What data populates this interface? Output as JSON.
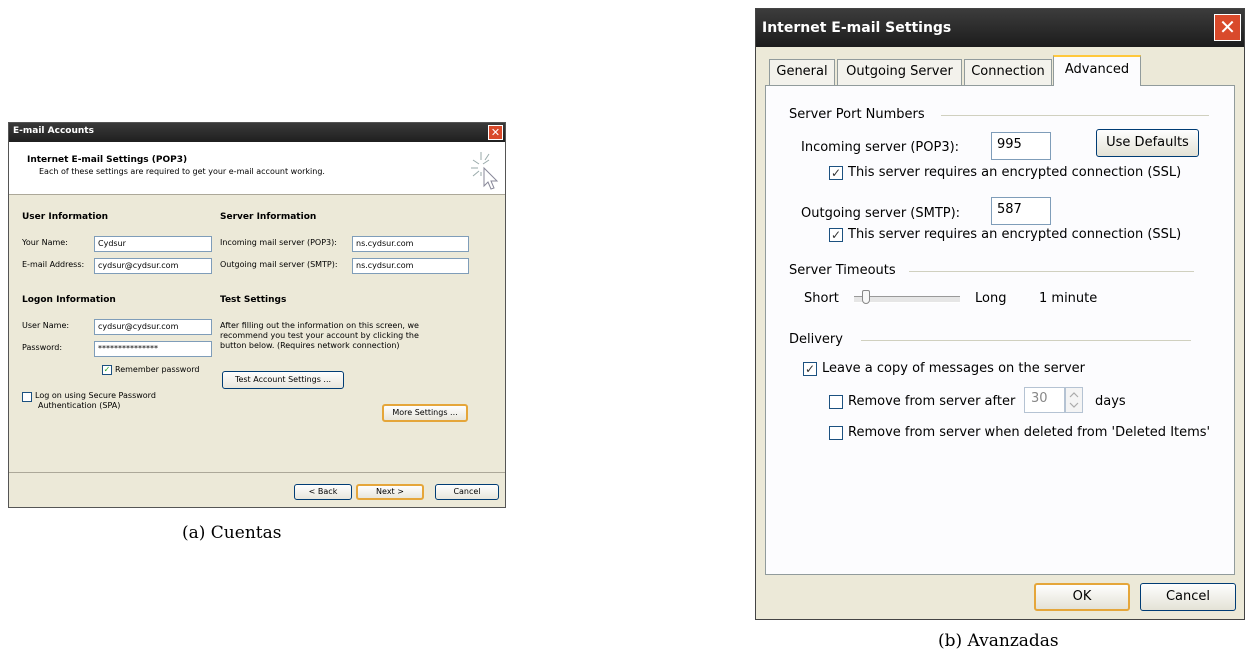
{
  "left": {
    "title": "E-mail Accounts",
    "close_glyph": "✕",
    "header_title": "Internet E-mail Settings (POP3)",
    "header_subtitle": "Each of these settings are required to get your e-mail account working.",
    "user_info": {
      "heading": "User Information",
      "name_label": "Your Name:",
      "name_value": "Cydsur",
      "email_label": "E-mail Address:",
      "email_value": "cydsur@cydsur.com"
    },
    "server_info": {
      "heading": "Server Information",
      "incoming_label": "Incoming mail server (POP3):",
      "incoming_value": "ns.cydsur.com",
      "outgoing_label": "Outgoing mail server (SMTP):",
      "outgoing_value": "ns.cydsur.com"
    },
    "logon_info": {
      "heading": "Logon Information",
      "username_label": "User Name:",
      "username_value": "cydsur@cydsur.com",
      "password_label": "Password:",
      "password_value": "***************",
      "remember_label": "Remember password",
      "remember_checked": true,
      "spa_label_line1": "Log on using Secure Password",
      "spa_label_line2": "Authentication (SPA)",
      "spa_checked": false
    },
    "test_settings": {
      "heading": "Test Settings",
      "text_line1": "After filling out the information on this screen, we",
      "text_line2": "recommend you test your account by clicking the",
      "text_line3": "button below. (Requires network connection)",
      "test_button": "Test Account Settings ...",
      "more_button": "More Settings ..."
    },
    "footer": {
      "back": "< Back",
      "next": "Next >",
      "cancel": "Cancel"
    },
    "caption": "(a) Cuentas"
  },
  "right": {
    "title": "Internet E-mail Settings",
    "close_glyph": "✕",
    "tabs": [
      {
        "label": "General",
        "active": false
      },
      {
        "label": "Outgoing Server",
        "active": false
      },
      {
        "label": "Connection",
        "active": false
      },
      {
        "label": "Advanced",
        "active": true
      }
    ],
    "ports": {
      "heading": "Server Port Numbers",
      "incoming_label": "Incoming server (POP3):",
      "incoming_value": "995",
      "use_defaults": "Use Defaults",
      "incoming_ssl_label": "This server requires an encrypted connection (SSL)",
      "incoming_ssl_checked": true,
      "outgoing_label": "Outgoing server (SMTP):",
      "outgoing_value": "587",
      "outgoing_ssl_label": "This server requires an encrypted connection (SSL)",
      "outgoing_ssl_checked": true
    },
    "timeouts": {
      "heading": "Server Timeouts",
      "short_label": "Short",
      "long_label": "Long",
      "value_label": "1 minute",
      "slider_level": 0.1
    },
    "delivery": {
      "heading": "Delivery",
      "leave_copy_label": "Leave a copy of messages on the server",
      "leave_copy_checked": true,
      "remove_after_label": "Remove from server after",
      "remove_after_checked": false,
      "days_value": "30",
      "days_label": "days",
      "remove_deleted_label": "Remove from server when deleted from 'Deleted Items'",
      "remove_deleted_checked": false
    },
    "footer": {
      "ok": "OK",
      "cancel": "Cancel"
    },
    "caption": "(b) Avanzadas"
  },
  "check_glyph": "✓"
}
